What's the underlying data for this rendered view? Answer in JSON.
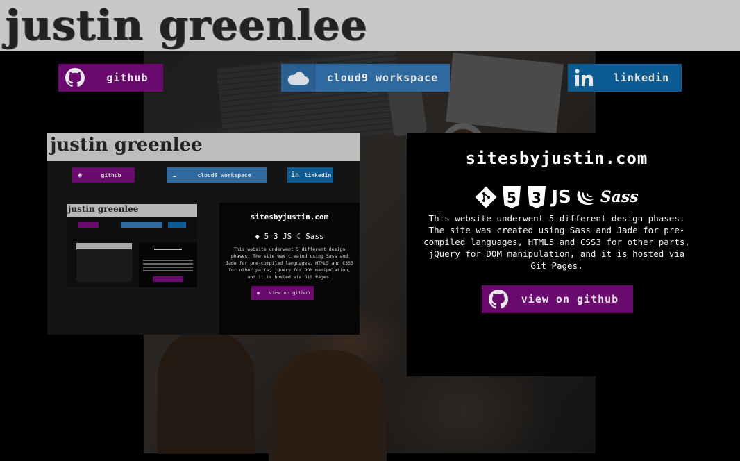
{
  "header": {
    "title": "justin greenlee"
  },
  "nav": {
    "github": {
      "label": "github",
      "icon": "github-icon"
    },
    "cloud9": {
      "label": "cloud9 workspace",
      "icon": "cloud-icon"
    },
    "linkedin": {
      "label": "linkedin",
      "icon": "linkedin-icon"
    }
  },
  "preview": {
    "title": "justin greenlee",
    "github": "github",
    "cloud9": "cloud9 workspace",
    "linkedin": "linkedin",
    "card_title": "sitesbyjustin.com",
    "card_desc": "This website underwent 5 different design phases. The site was created using Sass and Jade for pre-compiled languages, HTML5 and CSS3 for other parts, jQuery for DOM manipulation, and it is hosted via Git Pages.",
    "card_button": "view on github"
  },
  "project": {
    "title": "sitesbyjustin.com",
    "icons": [
      "git-icon",
      "html5-icon",
      "css3-icon",
      "js-icon",
      "jquery-icon",
      "sass-icon"
    ],
    "js_text": "JS",
    "sass_text": "Sass",
    "description": "This website underwent 5 different design phases. The site was created using Sass and Jade for pre-compiled languages, HTML5 and CSS3 for other parts, jQuery for DOM manipulation, and it is hosted via Git Pages.",
    "button_label": "view on github"
  },
  "colors": {
    "github": "#6a0a6e",
    "cloud9": "#2e6aa0",
    "linkedin": "#0c5b93",
    "header_bg": "#c8c8c8"
  }
}
